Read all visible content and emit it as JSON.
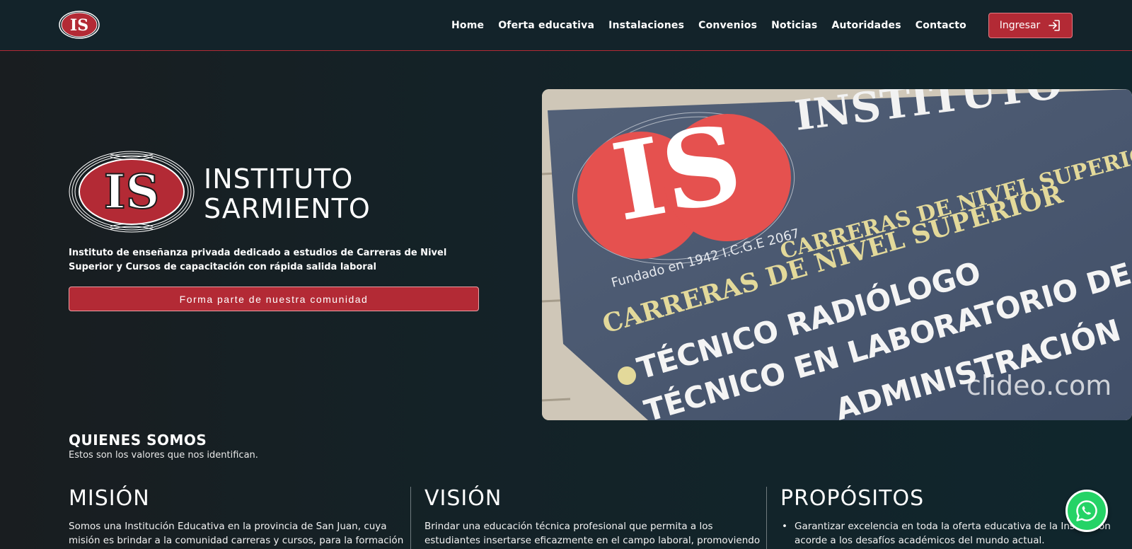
{
  "brand": {
    "logo_text": "IS",
    "name_line1": "INSTITUTO",
    "name_line2": "SARMIENTO"
  },
  "nav": {
    "links": [
      "Home",
      "Oferta educativa",
      "Instalaciones",
      "Convenios",
      "Noticias",
      "Autoridades",
      "Contacto"
    ],
    "login_label": "Ingresar",
    "login_icon": "sign-in-icon"
  },
  "hero": {
    "description": "Instituto de enseñanza privada dedicado a estudios de Carreras de Nivel Superior y Cursos de capacitación con rápida salida laboral",
    "cta_label": "Forma parte de nuestra comunidad",
    "image": {
      "sign_header": "INSTITUTO",
      "logo_text": "IS",
      "subtitle": "CARRERAS DE NIVEL SUPERIOR",
      "founded": "Fundado en 1942 I.C.G.E 2067",
      "heading": "CARRERAS DE NIVEL SUPERIOR",
      "item1": "TÉCNICO RADIÓLOGO",
      "item2": "TÉCNICO EN LABORATORIO DE A",
      "item3": "ADMINISTRACIÓN",
      "watermark": "clideo.com"
    }
  },
  "about": {
    "title": "QUIENES SOMOS",
    "subtitle": "Estos son los valores que nos identifican.",
    "mision_title": "MISIÓN",
    "mision_text": "Somos una Institución Educativa en la provincia de San Juan, cuya misión es brindar a la comunidad carreras y cursos, para la formación",
    "vision_title": "VISIÓN",
    "vision_text": "Brindar una educación técnica profesional que permita a los estudiantes insertarse eficazmente en el campo laboral, promoviendo",
    "propositos_title": "PROPÓSITOS",
    "propositos_item1": "Garantizar excelencia en toda la oferta educativa de la Institución acorde a los desafíos académicos del mundo actual."
  },
  "colors": {
    "accent": "#b32a35",
    "background": "#13232a",
    "whatsapp": "#25d366"
  },
  "widgets": {
    "whatsapp_icon": "whatsapp-icon"
  }
}
